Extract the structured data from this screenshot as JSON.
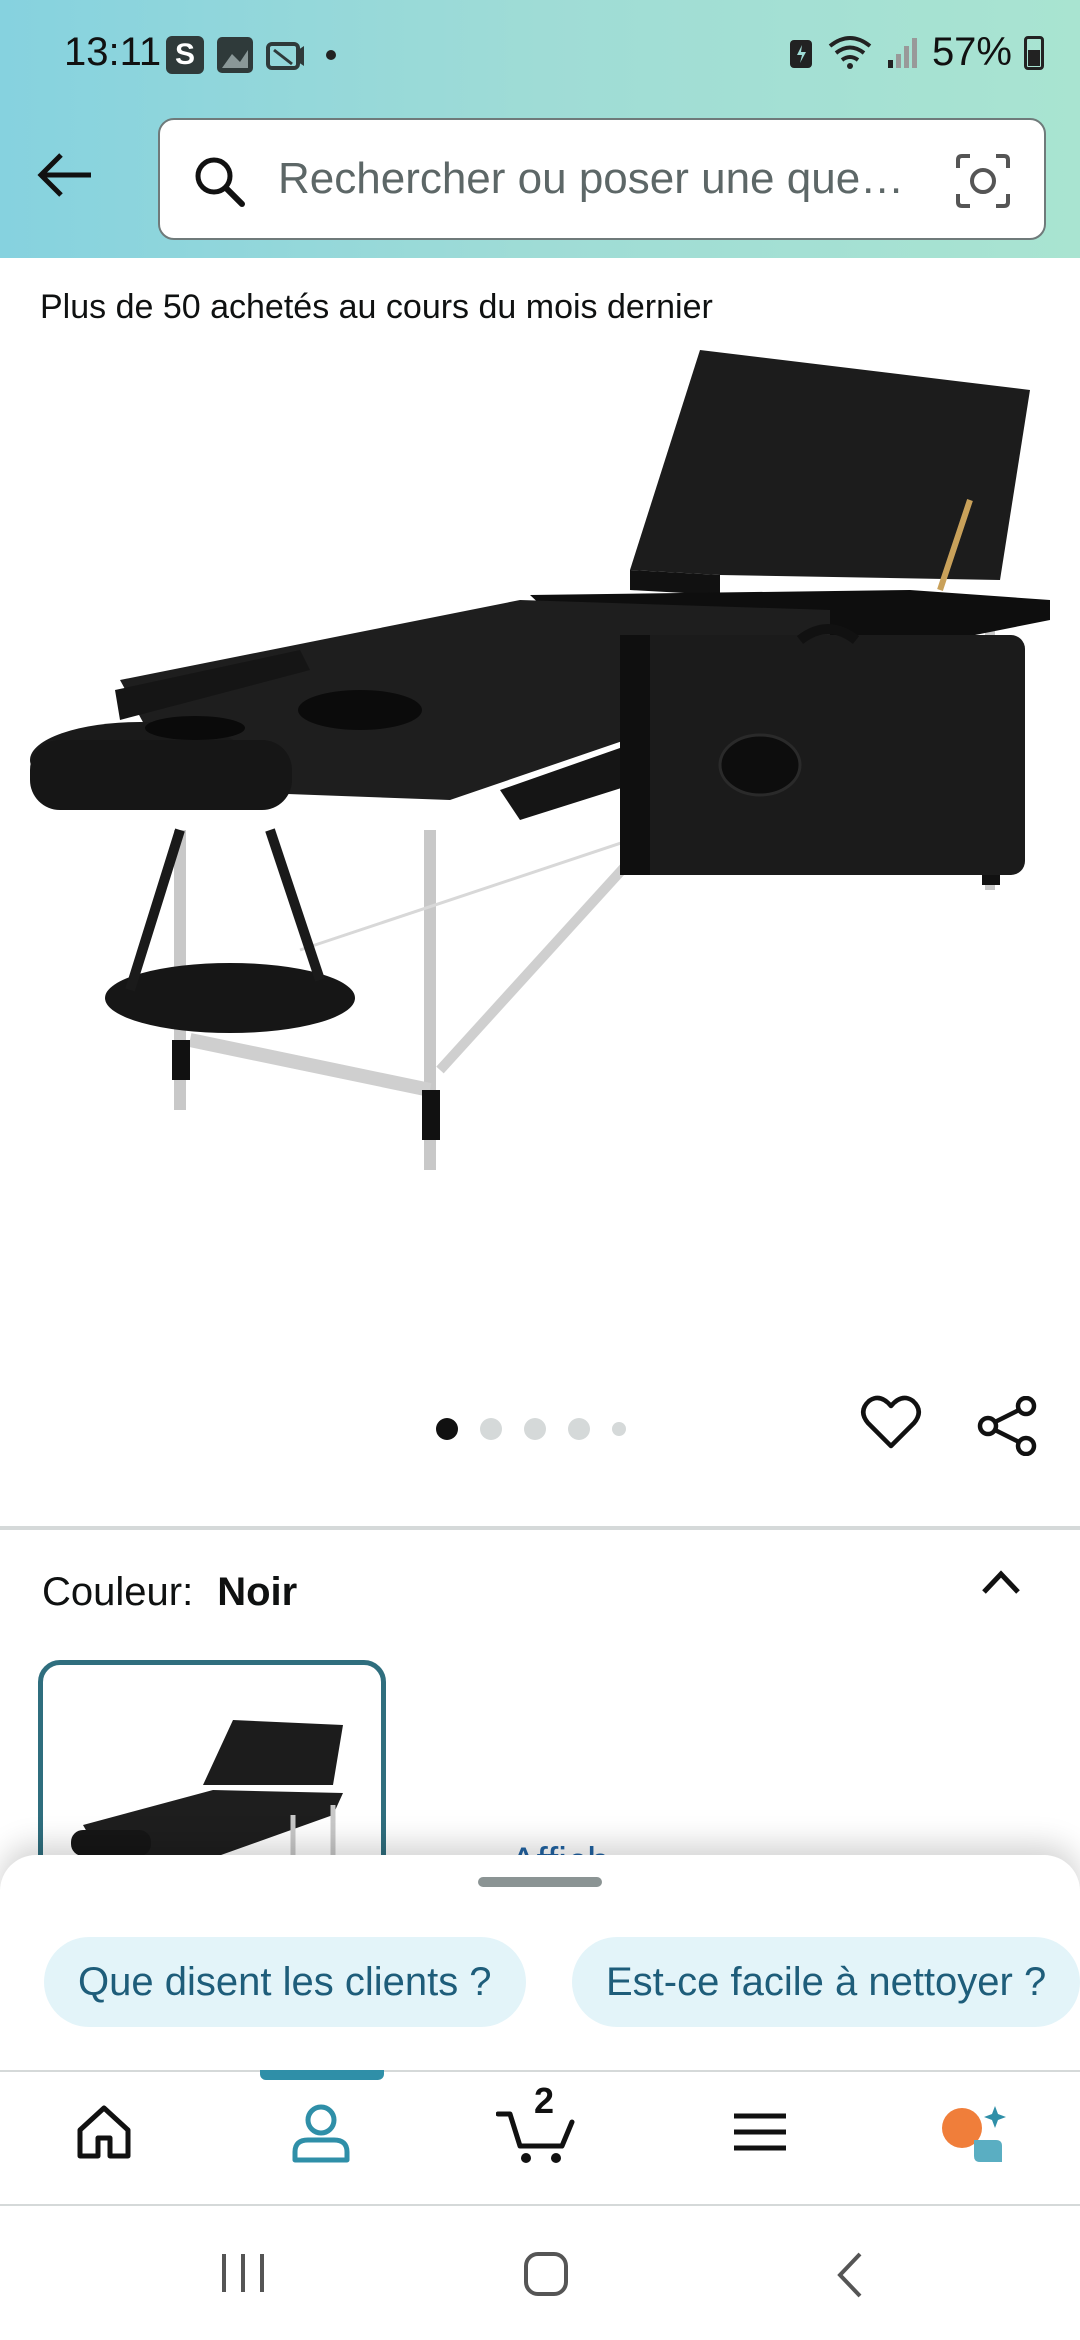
{
  "status_bar": {
    "time": "13:11",
    "app_icon_s": "S",
    "battery": "57%"
  },
  "header": {
    "search_placeholder": "Rechercher ou poser une que…"
  },
  "product": {
    "bought_line": "Plus de 50 achetés au cours du mois dernier",
    "image_count": 5,
    "active_image": 1
  },
  "color": {
    "label": "Couleur:",
    "value": "Noir"
  },
  "afficher_text": "Affich",
  "suggestions": [
    "Que disent les clients ?",
    "Est-ce facile à nettoyer ?"
  ],
  "nav": {
    "cart_count": "2",
    "active": "account"
  },
  "colors": {
    "accent": "#2f8fa8",
    "chip_bg": "#e3f4f9",
    "chip_text": "#1e5d7a",
    "swatch_border": "#2f6e7e",
    "link": "#2162a1"
  }
}
